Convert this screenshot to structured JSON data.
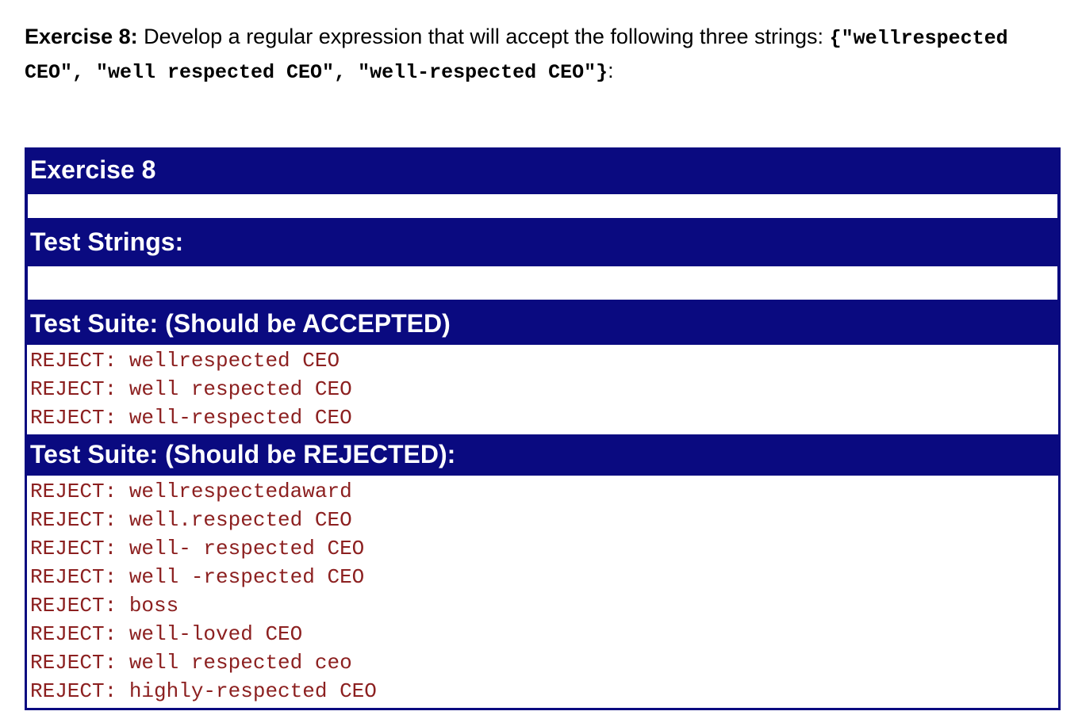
{
  "prompt": {
    "lead": "Exercise 8:",
    "text_1": " Develop a regular expression that will accept the following three strings: ",
    "code_1": "{\"wellrespected CEO\", \"well respected CEO\", \"well-respected CEO\"}",
    "text_2": ":"
  },
  "colors": {
    "navy": "#0A0A80",
    "result_text": "#8C2020",
    "page_background": "#FFFFFF",
    "header_text": "#FFFFFF"
  },
  "table": {
    "title_bar": "Exercise 8",
    "regex_input": {
      "value": "",
      "placeholder": ""
    },
    "test_strings_bar": "Test Strings:",
    "test_strings_input": {
      "value": "",
      "placeholder": ""
    },
    "accepted_bar": "Test Suite: (Should be ACCEPTED)",
    "accepted_results": [
      {
        "verdict": "REJECT:",
        "subject": "wellrespected CEO"
      },
      {
        "verdict": "REJECT:",
        "subject": "well respected CEO"
      },
      {
        "verdict": "REJECT:",
        "subject": "well-respected CEO"
      }
    ],
    "rejected_bar": "Test Suite: (Should be REJECTED):",
    "rejected_results": [
      {
        "verdict": "REJECT:",
        "subject": "wellrespectedaward"
      },
      {
        "verdict": "REJECT:",
        "subject": "well.respected CEO"
      },
      {
        "verdict": "REJECT:",
        "subject": "well- respected CEO"
      },
      {
        "verdict": "REJECT:",
        "subject": "well -respected CEO"
      },
      {
        "verdict": "REJECT:",
        "subject": "boss"
      },
      {
        "verdict": "REJECT:",
        "subject": "well-loved CEO"
      },
      {
        "verdict": "REJECT:",
        "subject": "well respected ceo"
      },
      {
        "verdict": "REJECT:",
        "subject": "highly-respected CEO"
      }
    ]
  }
}
